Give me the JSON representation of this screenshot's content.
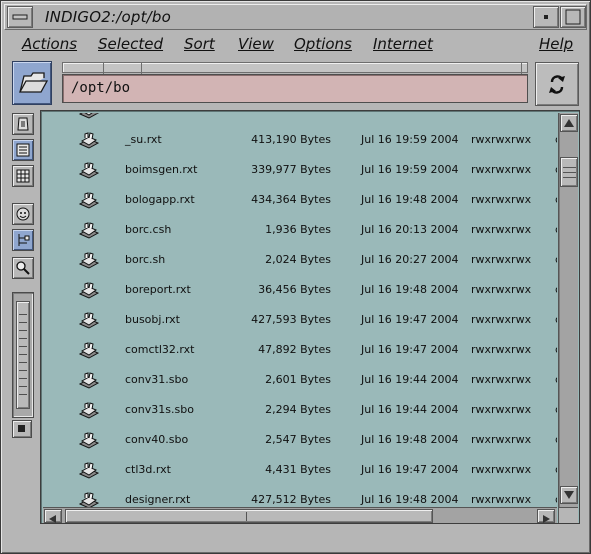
{
  "window": {
    "title": "INDIGO2:/opt/bo",
    "menu_button_icon": "window-menu-icon",
    "minimize_icon": "minimize-icon",
    "maximize_icon": "maximize-icon"
  },
  "menubar": {
    "items": [
      {
        "label": "Actions",
        "mnemonic": "A"
      },
      {
        "label": "Selected",
        "mnemonic": "S"
      },
      {
        "label": "Sort",
        "mnemonic": "r"
      },
      {
        "label": "View",
        "mnemonic": "V"
      },
      {
        "label": "Options",
        "mnemonic": "O"
      },
      {
        "label": "Internet",
        "mnemonic": "I"
      },
      {
        "label": "Help",
        "mnemonic": "H"
      }
    ]
  },
  "toolbar": {
    "folder_icon": "open-folder-icon",
    "path": "/opt/bo",
    "refresh_icon": "refresh-arrows-icon"
  },
  "sidebar": {
    "tools": [
      {
        "name": "view-icons-button",
        "icon": "icon-view-icon",
        "active": false
      },
      {
        "name": "view-list-button",
        "icon": "list-view-icon",
        "active": true
      },
      {
        "name": "view-columns-button",
        "icon": "column-view-icon",
        "active": false
      },
      {
        "name": "view-face-button",
        "icon": "face-icon",
        "active": false
      },
      {
        "name": "view-tree-button",
        "icon": "tree-icon",
        "active": true
      },
      {
        "name": "find-button",
        "icon": "magnifier-icon",
        "active": false
      }
    ],
    "zoom_close_icon": "square-icon"
  },
  "colors": {
    "list_background": "#9ab9b9",
    "path_field_background": "#d2b4b4",
    "active_button": "#8fa6cf",
    "chrome": "#b6b6b6"
  },
  "files": [
    {
      "name": "",
      "size": "",
      "date": "",
      "perms": "",
      "more": ""
    },
    {
      "name": "_su.rxt",
      "size": "413,190 Bytes",
      "date": "Jul 16 19:59 2004",
      "perms": "rwxrwxrwx",
      "more": "c"
    },
    {
      "name": "boimsgen.rxt",
      "size": "339,977 Bytes",
      "date": "Jul 16 19:59 2004",
      "perms": "rwxrwxrwx",
      "more": "c"
    },
    {
      "name": "bologapp.rxt",
      "size": "434,364 Bytes",
      "date": "Jul 16 19:48 2004",
      "perms": "rwxrwxrwx",
      "more": "c"
    },
    {
      "name": "borc.csh",
      "size": "1,936 Bytes",
      "date": "Jul 16 20:13 2004",
      "perms": "rwxrwxrwx",
      "more": "c"
    },
    {
      "name": "borc.sh",
      "size": "2,024 Bytes",
      "date": "Jul 16 20:27 2004",
      "perms": "rwxrwxrwx",
      "more": "c"
    },
    {
      "name": "boreport.rxt",
      "size": "36,456 Bytes",
      "date": "Jul 16 19:48 2004",
      "perms": "rwxrwxrwx",
      "more": "c"
    },
    {
      "name": "busobj.rxt",
      "size": "427,593 Bytes",
      "date": "Jul 16 19:47 2004",
      "perms": "rwxrwxrwx",
      "more": "c"
    },
    {
      "name": "comctl32.rxt",
      "size": "47,892 Bytes",
      "date": "Jul 16 19:47 2004",
      "perms": "rwxrwxrwx",
      "more": "c"
    },
    {
      "name": "conv31.sbo",
      "size": "2,601 Bytes",
      "date": "Jul 16 19:44 2004",
      "perms": "rwxrwxrwx",
      "more": "c"
    },
    {
      "name": "conv31s.sbo",
      "size": "2,294 Bytes",
      "date": "Jul 16 19:44 2004",
      "perms": "rwxrwxrwx",
      "more": "c"
    },
    {
      "name": "conv40.sbo",
      "size": "2,547 Bytes",
      "date": "Jul 16 19:48 2004",
      "perms": "rwxrwxrwx",
      "more": "c"
    },
    {
      "name": "ctl3d.rxt",
      "size": "4,431 Bytes",
      "date": "Jul 16 19:47 2004",
      "perms": "rwxrwxrwx",
      "more": "c"
    },
    {
      "name": "designer.rxt",
      "size": "427,512 Bytes",
      "date": "Jul 16 19:48 2004",
      "perms": "rwxrwxrwx",
      "more": "c"
    }
  ],
  "scrollbars": {
    "up_icon": "arrow-up-icon",
    "down_icon": "arrow-down-icon",
    "left_icon": "arrow-left-icon",
    "right_icon": "arrow-right-icon"
  }
}
